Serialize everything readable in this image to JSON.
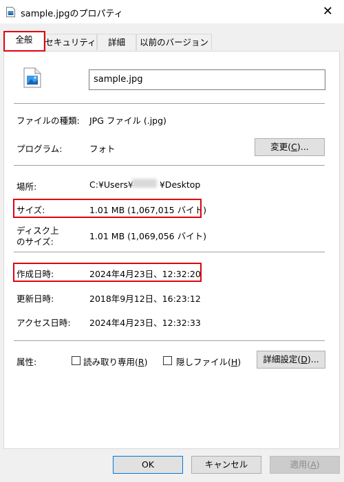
{
  "window": {
    "title": "sample.jpgのプロパティ"
  },
  "tabs": [
    "全般",
    "セキュリティ",
    "詳細",
    "以前のバージョン"
  ],
  "file_name": "sample.jpg",
  "rows": {
    "type": {
      "label": "ファイルの種類:",
      "value": "JPG ファイル (.jpg)"
    },
    "program": {
      "label": "プログラム:",
      "value": "フォト"
    },
    "location": {
      "label": "場所:",
      "value_prefix": "C:¥Users¥",
      "value_suffix": "¥Desktop"
    },
    "size": {
      "label": "サイズ:",
      "value": "1.01 MB (1,067,015 バイト)"
    },
    "disk_size": {
      "label_line1": "ディスク上",
      "label_line2": "のサイズ:",
      "value": "1.01 MB (1,069,056 バイト)"
    },
    "created": {
      "label": "作成日時:",
      "value": "2024年4月23日、12:32:20"
    },
    "modified": {
      "label": "更新日時:",
      "value": "2018年9月12日、16:23:12"
    },
    "accessed": {
      "label": "アクセス日時:",
      "value": "2024年4月23日、12:32:33"
    }
  },
  "attributes": {
    "label": "属性:",
    "readonly": {
      "text": "読み取り専用(",
      "key": "R",
      "close": ")"
    },
    "hidden": {
      "text": "隠しファイル(",
      "key": "H",
      "close": ")"
    },
    "advanced": {
      "text": "詳細設定(",
      "key": "D",
      "close": ")..."
    }
  },
  "change_button": {
    "text": "変更(",
    "key": "C",
    "close": ")..."
  },
  "footer": {
    "ok": "OK",
    "cancel": "キャンセル",
    "apply": {
      "text": "適用(",
      "key": "A",
      "close": ")"
    }
  },
  "colors": {
    "highlight": "#e0000d",
    "accent": "#0078d7"
  }
}
